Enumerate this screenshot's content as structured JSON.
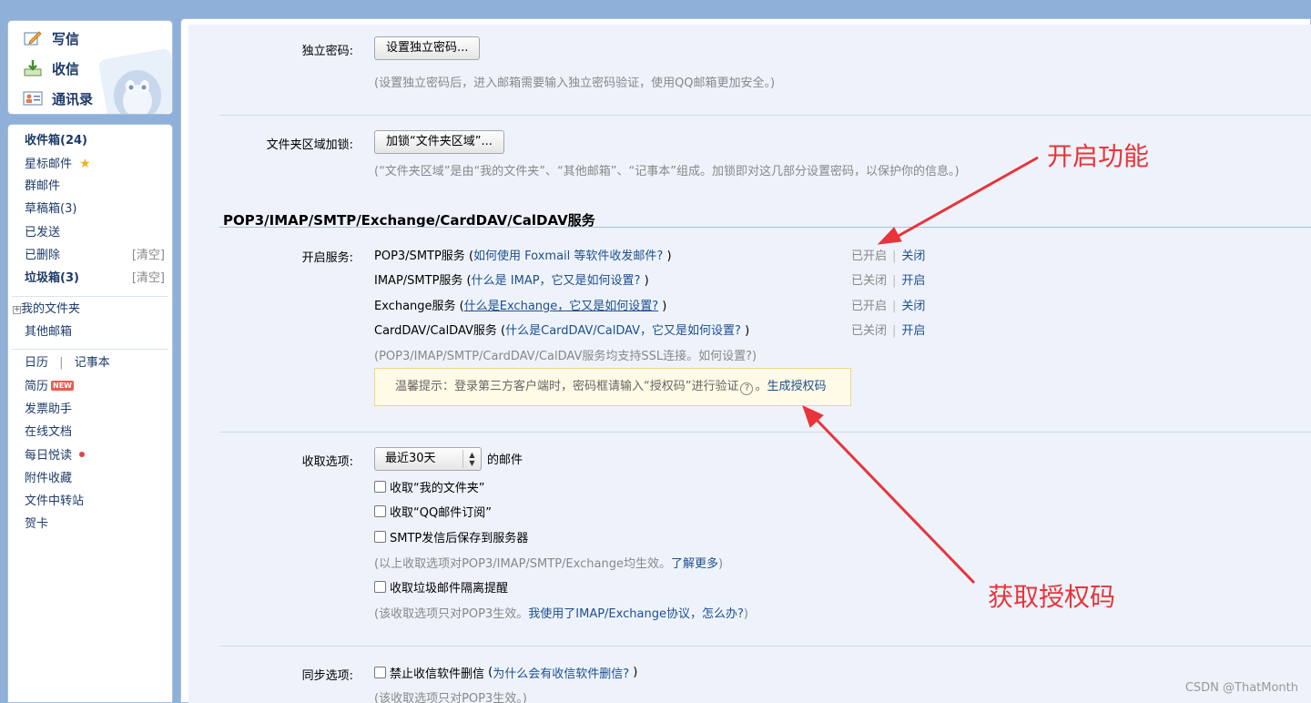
{
  "quick": {
    "compose": "写信",
    "inbox": "收信",
    "contacts": "通讯录"
  },
  "nav": {
    "inbox": "收件箱(24)",
    "starred": "星标邮件",
    "group": "群邮件",
    "drafts": "草稿箱(3)",
    "sent": "已发送",
    "deleted": "已删除",
    "deleted_clear": "[清空]",
    "spam": "垃圾箱(3)",
    "spam_clear": "[清空]",
    "my_folders": "我的文件夹",
    "other_mailboxes": "其他邮箱",
    "calendar": "日历",
    "calendar_sep": "|",
    "notebook": "记事本",
    "resume": "简历",
    "new_badge": "NEW",
    "invoice": "发票助手",
    "online_docs": "在线文档",
    "daily_read": "每日悦读",
    "attachments": "附件收藏",
    "file_transfer": "文件中转站",
    "cards": "贺卡"
  },
  "settings": {
    "independent_password": {
      "label": "独立密码:",
      "button": "设置独立密码...",
      "hint": "(设置独立密码后，进入邮箱需要输入独立密码验证，使用QQ邮箱更加安全。)"
    },
    "folder_lock": {
      "label": "文件夹区域加锁:",
      "button": "加锁“文件夹区域”...",
      "hint": "(“文件夹区域”是由“我的文件夹”、“其他邮箱”、“记事本”组成。加锁即对这几部分设置密码，以保护你的信息。)"
    },
    "section_title": "POP3/IMAP/SMTP/Exchange/CardDAV/CalDAV服务",
    "services_label": "开启服务:",
    "services": [
      {
        "name": "POP3/SMTP服务",
        "pre": " (",
        "help": "如何使用 Foxmail 等软件收发邮件?",
        "post": " )",
        "state": "已开启",
        "sep": "|",
        "action": "关闭"
      },
      {
        "name": "IMAP/SMTP服务",
        "pre": " (",
        "help": "什么是 IMAP，它又是如何设置?",
        "post": " )",
        "state": "已关闭",
        "sep": "|",
        "action": "开启"
      },
      {
        "name": "Exchange服务",
        "pre": " (",
        "help": "什么是Exchange，它又是如何设置?",
        "post": " )",
        "state": "已开启",
        "sep": "|",
        "action": "关闭"
      },
      {
        "name": "CardDAV/CalDAV服务",
        "pre": " (",
        "help": "什么是CardDAV/CalDAV，它又是如何设置?",
        "post": " )",
        "state": "已关闭",
        "sep": "|",
        "action": "开启"
      }
    ],
    "ssl_hint_pre": "(POP3/IMAP/SMTP/CardDAV/CalDAV服务均支持SSL连接。",
    "ssl_hint_link": "如何设置?",
    "ssl_hint_post": ")",
    "tip_text": "温馨提示：登录第三方客户端时，密码框请输入“授权码”进行验证",
    "tip_qmark": "?",
    "tip_dot": "。",
    "tip_link": "生成授权码",
    "receive_label": "收取选项:",
    "receive_select": "最近30天",
    "receive_suffix": "的邮件",
    "cb_my_folders": "收取“我的文件夹”",
    "cb_qq_sub": "收取“QQ邮件订阅”",
    "cb_smtp_save": "SMTP发信后保存到服务器",
    "receive_hint_pre": "(以上收取选项对POP3/IMAP/SMTP/Exchange均生效。",
    "receive_hint_link": "了解更多",
    "receive_hint_post": ")",
    "cb_spam": "收取垃圾邮件隔离提醒",
    "pop3_hint_pre": "(该收取选项只对POP3生效。",
    "pop3_hint_link": "我使用了IMAP/Exchange协议，怎么办?",
    "pop3_hint_post": ")",
    "sync_label": "同步选项:",
    "cb_no_delete": "禁止收信软件删信",
    "sync_help_pre": " (",
    "sync_help": "为什么会有收信软件删信?",
    "sync_help_post": " )",
    "sync_hint": "(该收取选项只对POP3生效。)"
  },
  "annotations": {
    "enable": "开启功能",
    "authcode": "获取授权码",
    "color": "#e8343a"
  },
  "watermark": "CSDN @ThatMonth"
}
